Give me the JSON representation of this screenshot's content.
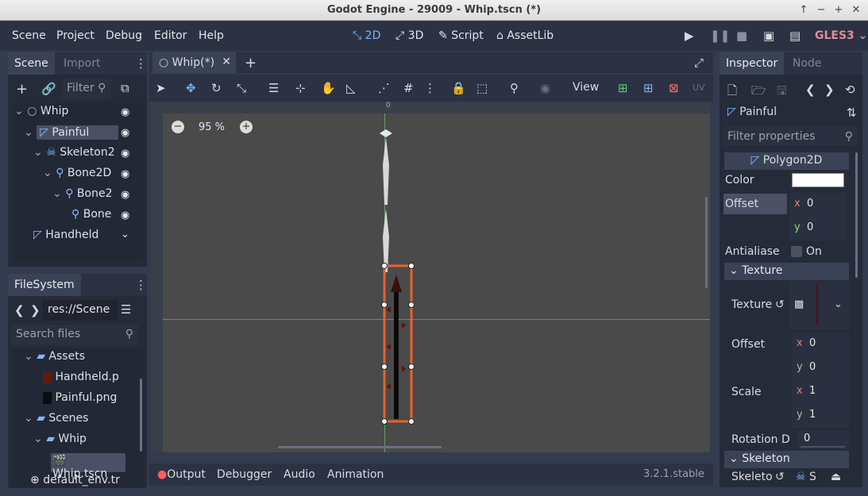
{
  "window": {
    "title": "Godot Engine - 29009 - Whip.tscn (*)",
    "controls": [
      "↑",
      "−",
      "+",
      "✕"
    ]
  },
  "menu": [
    "Scene",
    "Project",
    "Debug",
    "Editor",
    "Help"
  ],
  "workspaces": [
    {
      "label": "2D",
      "icon": "2d-icon"
    },
    {
      "label": "3D",
      "icon": "3d-icon"
    },
    {
      "label": "Script",
      "icon": "script-icon"
    },
    {
      "label": "AssetLib",
      "icon": "assetlib-icon"
    }
  ],
  "renderer": "GLES3",
  "scene_dock": {
    "tabs": [
      "Scene",
      "Import"
    ],
    "filter_placeholder": "Filter",
    "nodes": [
      {
        "label": "Whip",
        "icon": "node2d-icon"
      },
      {
        "label": "Painful",
        "icon": "polygon2d-icon"
      },
      {
        "label": "Skeleton2",
        "icon": "skeleton-icon"
      },
      {
        "label": "Bone2D",
        "icon": "bone-icon"
      },
      {
        "label": "Bone2",
        "icon": "bone-icon"
      },
      {
        "label": "Bone",
        "icon": "bone-icon"
      },
      {
        "label": "Handheld",
        "icon": "polygon2d-icon"
      }
    ]
  },
  "filesystem": {
    "title": "FileSystem",
    "path": "res://Scene",
    "search_placeholder": "Search files",
    "items": [
      {
        "label": "Assets",
        "type": "folder"
      },
      {
        "label": "Handheld.p",
        "type": "image"
      },
      {
        "label": "Painful.png",
        "type": "image"
      },
      {
        "label": "Scenes",
        "type": "folder"
      },
      {
        "label": "Whip",
        "type": "folder"
      },
      {
        "label": "Whip.tscn",
        "type": "scene"
      },
      {
        "label": "default_env.tr",
        "type": "resource"
      }
    ]
  },
  "editor": {
    "tab": "Whip(*)",
    "zoom": "95 %",
    "view_menu": "View",
    "ruler_zero": "0"
  },
  "bottom": {
    "tabs": [
      "Output",
      "Debugger",
      "Audio",
      "Animation"
    ],
    "version": "3.2.1.stable"
  },
  "inspector": {
    "tabs": [
      "Inspector",
      "Node"
    ],
    "node_name": "Painful",
    "filter_placeholder": "Filter properties",
    "class_name": "Polygon2D",
    "color_label": "Color",
    "color_value": "#ffffff",
    "offset_label": "Offset",
    "offset_x": "0",
    "offset_y": "0",
    "antialiased_label": "Antialiase",
    "antialiased_value": "On",
    "texture_section": "Texture",
    "texture_label": "Texture",
    "tex_offset_label": "Offset",
    "tex_offset_x": "0",
    "tex_offset_y": "0",
    "scale_label": "Scale",
    "scale_x": "1",
    "scale_y": "1",
    "rotation_label": "Rotation D",
    "rotation_value": "0",
    "skeleton_section": "Skeleton",
    "skeleton_label": "Skeleto",
    "skeleton_value": "S",
    "axis_x": "x",
    "axis_y": "y"
  }
}
